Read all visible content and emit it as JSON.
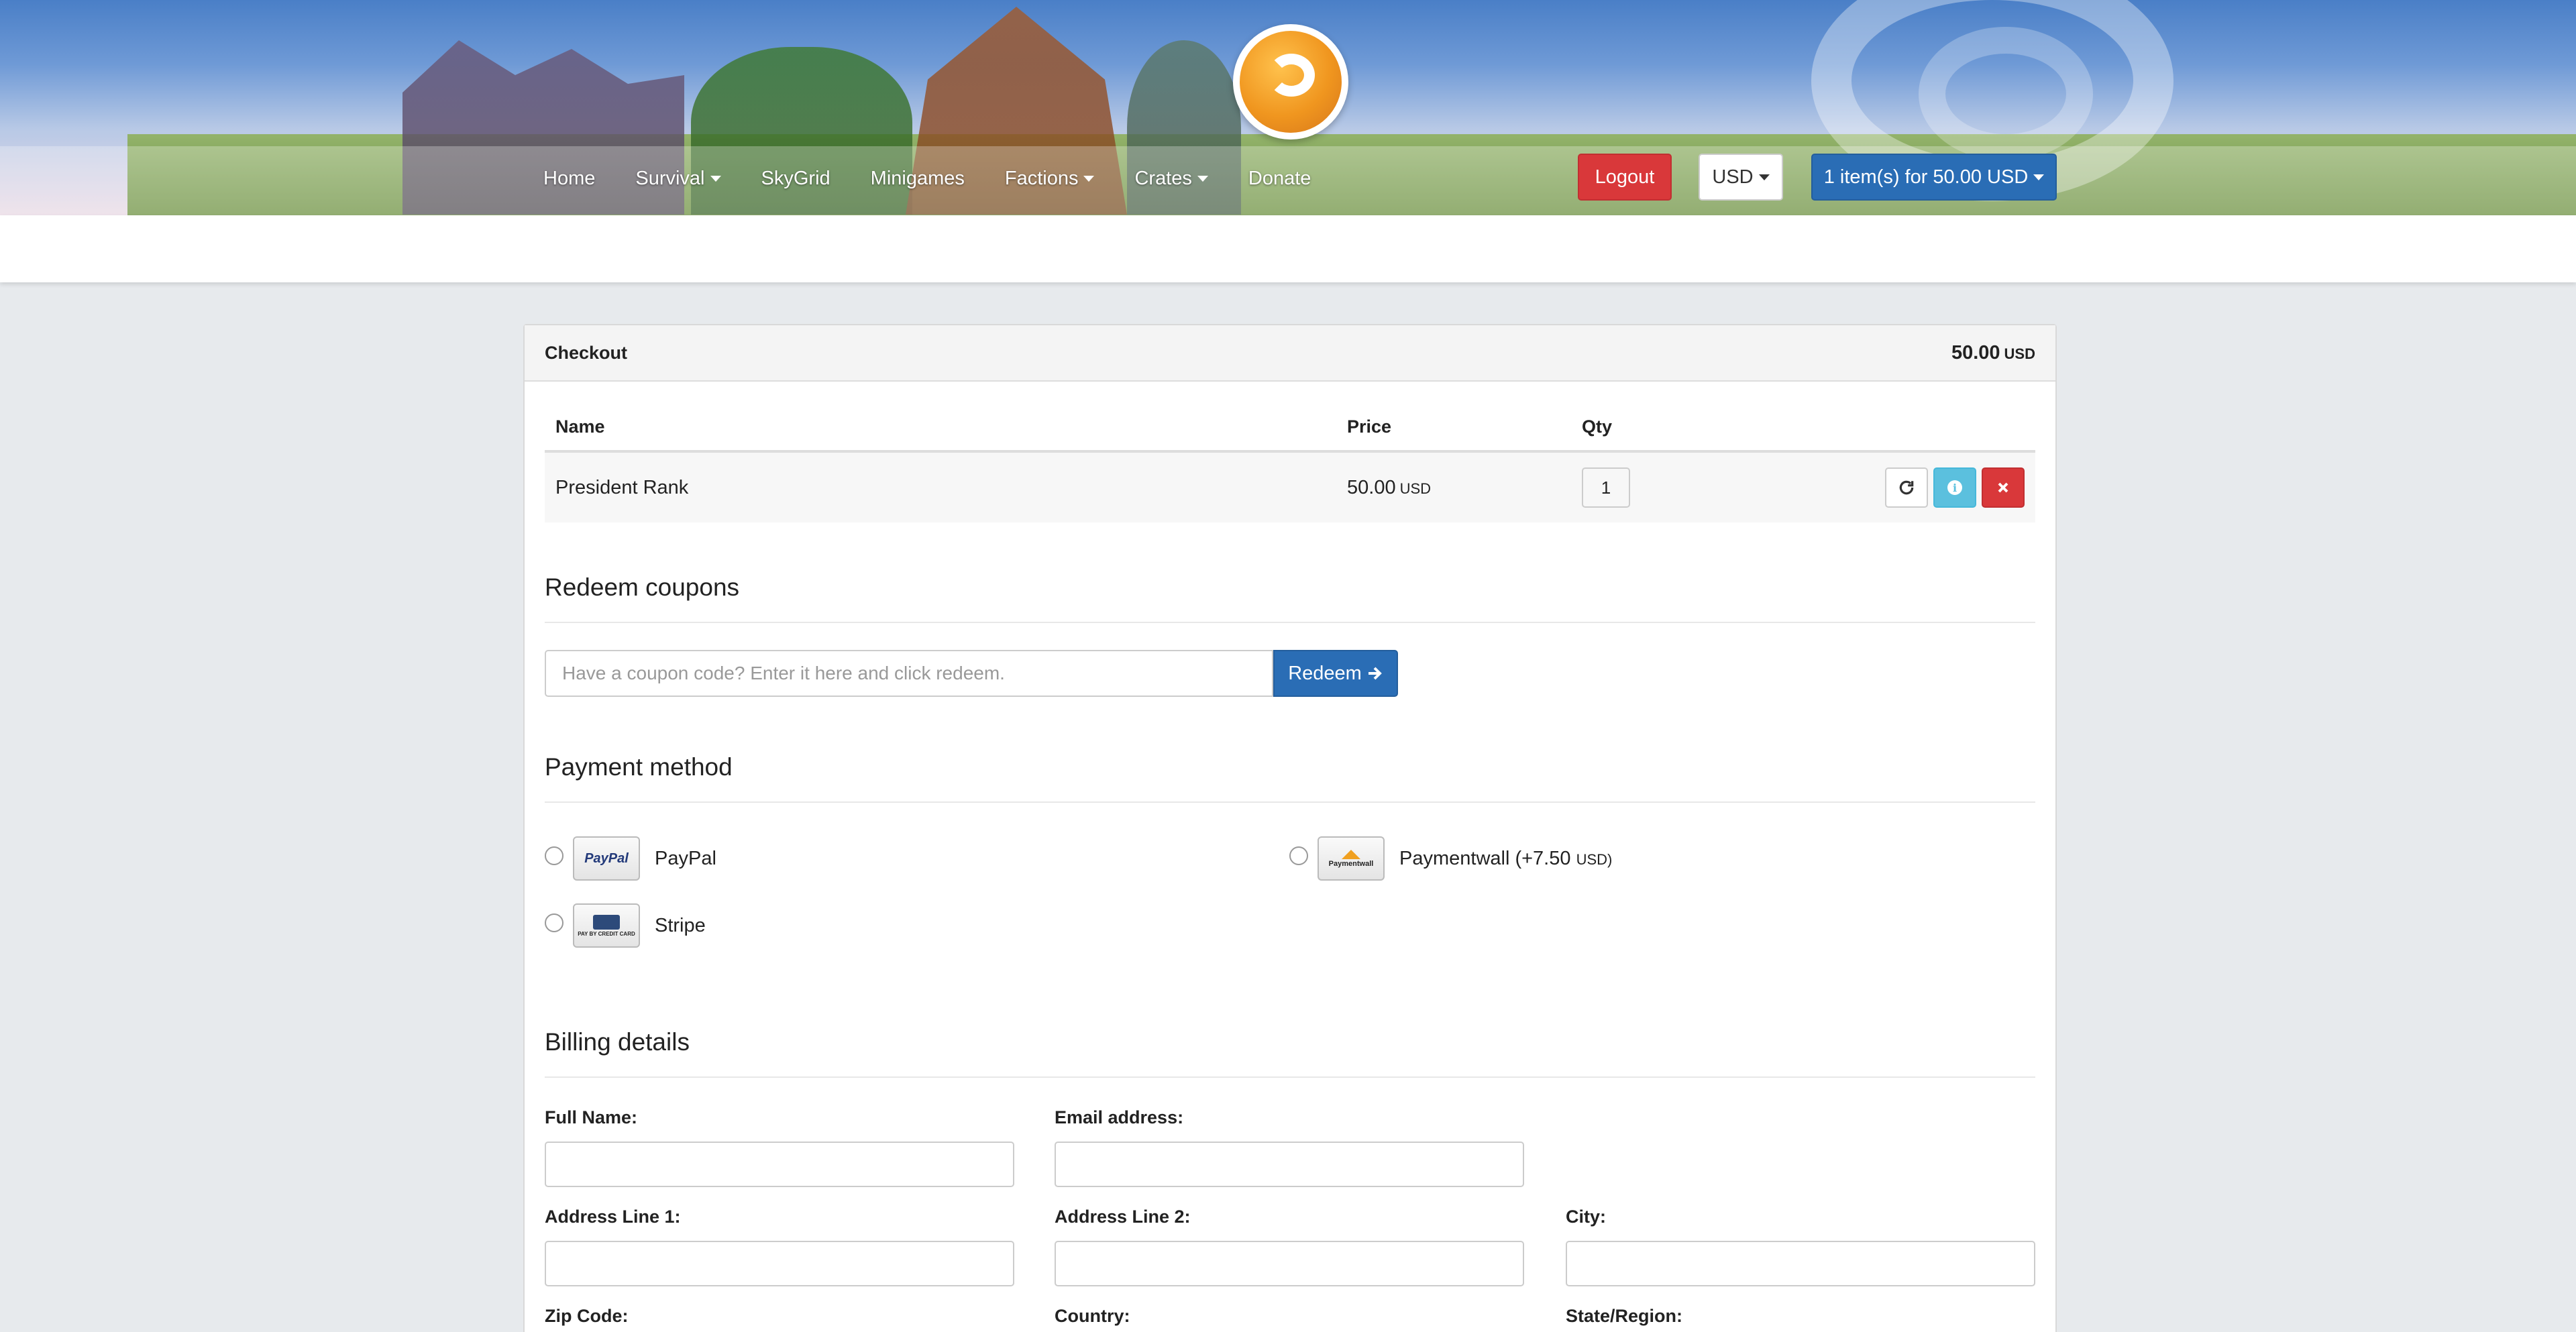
{
  "header": {
    "nav": [
      {
        "label": "Home",
        "dropdown": false
      },
      {
        "label": "Survival",
        "dropdown": true
      },
      {
        "label": "SkyGrid",
        "dropdown": false
      },
      {
        "label": "Minigames",
        "dropdown": false
      },
      {
        "label": "Factions",
        "dropdown": true
      },
      {
        "label": "Crates",
        "dropdown": true
      },
      {
        "label": "Donate",
        "dropdown": false
      }
    ],
    "logout_label": "Logout",
    "currency_label": "USD",
    "cart_label": "1 item(s) for 50.00 USD"
  },
  "checkout": {
    "title": "Checkout",
    "total": "50.00",
    "total_currency": "USD",
    "table": {
      "columns": [
        "Name",
        "Price",
        "Qty"
      ],
      "rows": [
        {
          "name": "President Rank",
          "price": "50.00",
          "currency": "USD",
          "qty": "1"
        }
      ]
    }
  },
  "coupons": {
    "title": "Redeem coupons",
    "placeholder": "Have a coupon code? Enter it here and click redeem.",
    "button_label": "Redeem"
  },
  "payment": {
    "title": "Payment method",
    "methods": [
      {
        "label": "PayPal",
        "logo_text": "PayPal",
        "extra": ""
      },
      {
        "label": "Paymentwall (+7.50",
        "logo_text": "Paymentwall",
        "extra_currency": "USD)"
      },
      {
        "label": "Stripe",
        "logo_text": "PAY BY CREDIT CARD",
        "extra": ""
      }
    ]
  },
  "billing": {
    "title": "Billing details",
    "fields": {
      "full_name": "Full Name:",
      "email": "Email address:",
      "address1": "Address Line 1:",
      "address2": "Address Line 2:",
      "city": "City:",
      "zip": "Zip Code:",
      "country": "Country:",
      "state": "State/Region:"
    }
  },
  "colors": {
    "primary": "#2a6db5",
    "danger": "#d9383a",
    "info": "#5bc0de",
    "page_bg": "#e7eaed"
  }
}
